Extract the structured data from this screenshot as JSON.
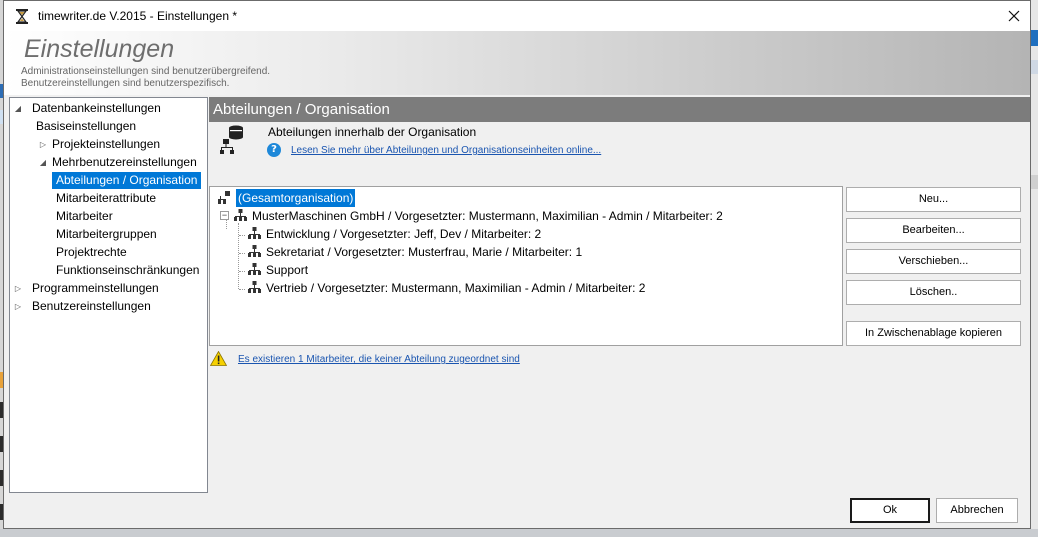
{
  "window": {
    "title": "timewriter.de V.2015 - Einstellungen *"
  },
  "header": {
    "title": "Einstellungen",
    "subtitle_line1": "Administrationseinstellungen sind benutzerübergreifend.",
    "subtitle_line2": "Benutzereinstellungen sind benutzerspezifisch."
  },
  "nav": {
    "items": [
      {
        "label": "Datenbankeinstellungen",
        "expander": "expanded",
        "selected": false
      },
      {
        "label": "Basiseinstellungen",
        "expander": "none",
        "selected": false
      },
      {
        "label": "Projekteinstellungen",
        "expander": "collapsed",
        "selected": false
      },
      {
        "label": "Mehrbenutzereinstellungen",
        "expander": "expanded",
        "selected": false
      },
      {
        "label": "Abteilungen / Organisation",
        "expander": "none",
        "selected": true
      },
      {
        "label": "Mitarbeiterattribute",
        "expander": "none",
        "selected": false
      },
      {
        "label": "Mitarbeiter",
        "expander": "none",
        "selected": false
      },
      {
        "label": "Mitarbeitergruppen",
        "expander": "none",
        "selected": false
      },
      {
        "label": "Projektrechte",
        "expander": "none",
        "selected": false
      },
      {
        "label": "Funktionseinschränkungen",
        "expander": "none",
        "selected": false
      },
      {
        "label": "Programmeinstellungen",
        "expander": "collapsed",
        "selected": false
      },
      {
        "label": "Benutzereinstellungen",
        "expander": "collapsed",
        "selected": false
      }
    ]
  },
  "section": {
    "title": "Abteilungen / Organisation",
    "heading": "Abteilungen innerhalb der Organisation",
    "help_link": "Lesen Sie mehr über Abteilungen und Organisationseinheiten online..."
  },
  "org_tree": {
    "nodes": [
      {
        "label": "(Gesamtorganisation)",
        "selected": true
      },
      {
        "label": "MusterMaschinen GmbH   / Vorgesetzter: Mustermann, Maximilian  - Admin   / Mitarbeiter: 2",
        "selected": false
      },
      {
        "label": "Entwicklung   / Vorgesetzter: Jeff, Dev    / Mitarbeiter: 2",
        "selected": false
      },
      {
        "label": "Sekretariat   / Vorgesetzter: Musterfrau, Marie    / Mitarbeiter: 1",
        "selected": false
      },
      {
        "label": "Support",
        "selected": false
      },
      {
        "label": "Vertrieb   / Vorgesetzter: Mustermann, Maximilian  - Admin   / Mitarbeiter: 2",
        "selected": false
      }
    ]
  },
  "buttons": {
    "new": "Neu...",
    "edit": "Bearbeiten...",
    "move": "Verschieben...",
    "delete": "Löschen..",
    "copy": "In Zwischenablage kopieren",
    "ok": "Ok",
    "cancel": "Abbrechen"
  },
  "warning": {
    "text": "Es existieren 1 Mitarbeiter, die keiner Abteilung zugeordnet sind"
  },
  "colors": {
    "selection": "#0078d7",
    "section_bar": "#7c7c7c",
    "link": "#1a55b0"
  }
}
